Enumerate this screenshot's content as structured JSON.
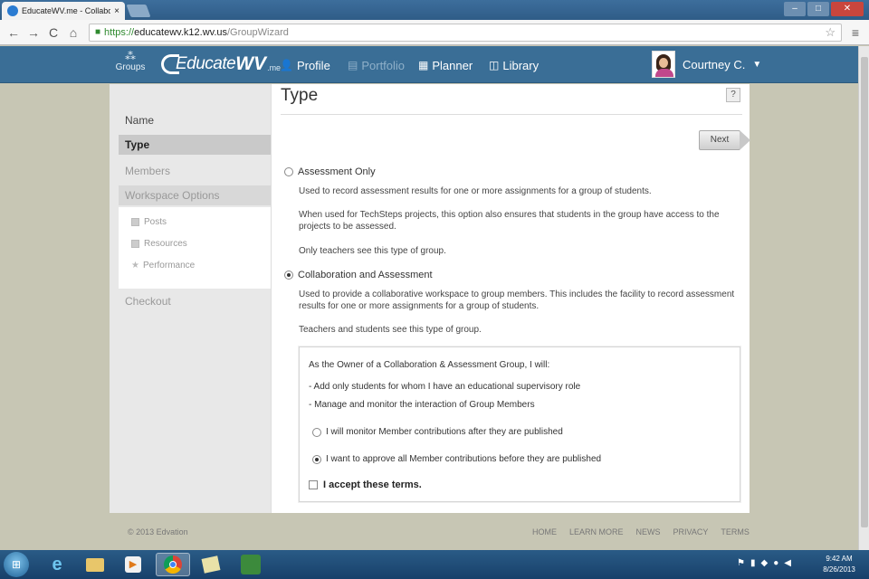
{
  "browser": {
    "tab_title": "EducateWV.me - Collabo",
    "tab_close": "×",
    "url_https": "https://",
    "url_host": "educatewv.k12.wv.us",
    "url_path": "/GroupWizard"
  },
  "header": {
    "groups_label": "Groups",
    "logo_text": "Educate",
    "logo_bold": "WV",
    "logo_suffix": ".me",
    "nav": [
      {
        "label": "Profile",
        "enabled": true
      },
      {
        "label": "Portfolio",
        "enabled": false
      },
      {
        "label": "Planner",
        "enabled": true
      },
      {
        "label": "Library",
        "enabled": true
      }
    ],
    "user_name": "Courtney C."
  },
  "wizard_steps": {
    "name": "Name",
    "type": "Type",
    "members": "Members",
    "workspace": "Workspace Options",
    "posts": "Posts",
    "resources": "Resources",
    "performance": "Performance",
    "checkout": "Checkout"
  },
  "main": {
    "title": "Type",
    "help": "?",
    "next": "Next",
    "options": [
      {
        "label": "Assessment Only",
        "checked": false,
        "desc1": "Used to record assessment results for one or more assignments for a group of students.",
        "desc2": "When used for TechSteps projects, this option also ensures that students in the group have access to the projects to be assessed.",
        "desc3": "Only teachers see this type of group."
      },
      {
        "label": "Collaboration and Assessment",
        "checked": true,
        "desc1": "Used to provide a collaborative workspace to group members. This includes the facility to record assessment results for one or more assignments for a group of students.",
        "desc2": "Teachers and students see this type of group."
      }
    ],
    "terms": {
      "intro": "As the Owner of a Collaboration & Assessment Group, I will:",
      "bullet1": "- Add only students for whom I have an educational supervisory role",
      "bullet2": "- Manage and monitor the interaction of Group Members",
      "opt1": "I will monitor Member contributions after they are published",
      "opt2": "I want to approve all Member contributions before they are published",
      "accept": "I accept these terms."
    }
  },
  "footer": {
    "copyright": "© 2013 Edvation",
    "links": [
      "HOME",
      "LEARN MORE",
      "NEWS",
      "PRIVACY",
      "TERMS"
    ]
  },
  "taskbar": {
    "time": "9:42 AM",
    "date": "8/26/2013"
  }
}
